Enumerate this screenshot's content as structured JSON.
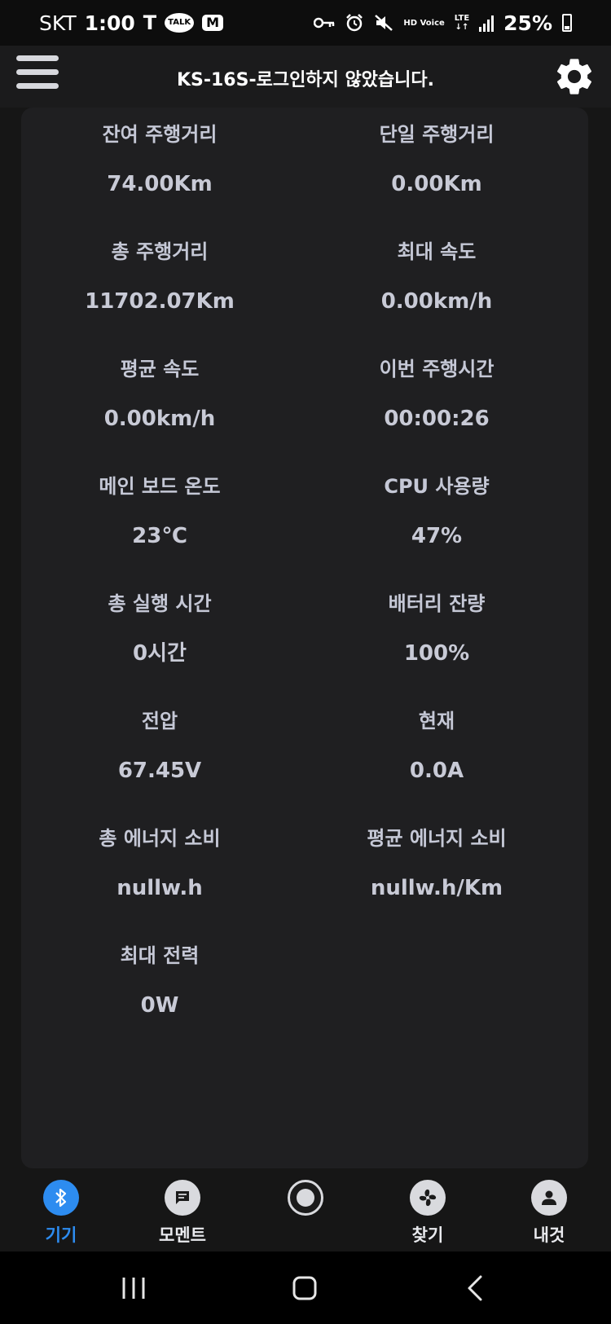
{
  "status_bar": {
    "carrier": "SKT",
    "time": "1:00",
    "app_tags": [
      "T",
      "TALK",
      "M"
    ],
    "network": "LTE",
    "hd_voice": "HD Voice",
    "battery": "25%"
  },
  "header": {
    "title": "KS-16S-로그인하지 않았습니다."
  },
  "stats": [
    {
      "label": "잔여 주행거리",
      "value": "74.00Km"
    },
    {
      "label": "단일 주행거리",
      "value": "0.00Km"
    },
    {
      "label": "총 주행거리",
      "value": "11702.07Km"
    },
    {
      "label": "최대 속도",
      "value": "0.00km/h"
    },
    {
      "label": "평균 속도",
      "value": "0.00km/h"
    },
    {
      "label": "이번 주행시간",
      "value": "00:00:26"
    },
    {
      "label": "메인 보드 온도",
      "value": "23℃"
    },
    {
      "label": "CPU 사용량",
      "value": "47%"
    },
    {
      "label": "총 실행 시간",
      "value": "0시간"
    },
    {
      "label": "배터리 잔량",
      "value": "100%"
    },
    {
      "label": "전압",
      "value": "67.45V"
    },
    {
      "label": "현재",
      "value": "0.0A"
    },
    {
      "label": "총 에너지 소비",
      "value": "nullw.h"
    },
    {
      "label": "평균 에너지 소비",
      "value": "nullw.h/Km"
    },
    {
      "label": "최대 전력",
      "value": "0W"
    }
  ],
  "bottom_nav": {
    "items": [
      {
        "label": "기기",
        "icon": "bluetooth-icon",
        "active": true
      },
      {
        "label": "모멘트",
        "icon": "chat-icon",
        "active": false
      },
      {
        "label": "",
        "icon": "record-icon",
        "active": false
      },
      {
        "label": "찾기",
        "icon": "fan-icon",
        "active": false
      },
      {
        "label": "내것",
        "icon": "person-icon",
        "active": false
      }
    ]
  },
  "colors": {
    "accent": "#2d8cf0",
    "card": "#1f1f21",
    "background": "#161616"
  }
}
